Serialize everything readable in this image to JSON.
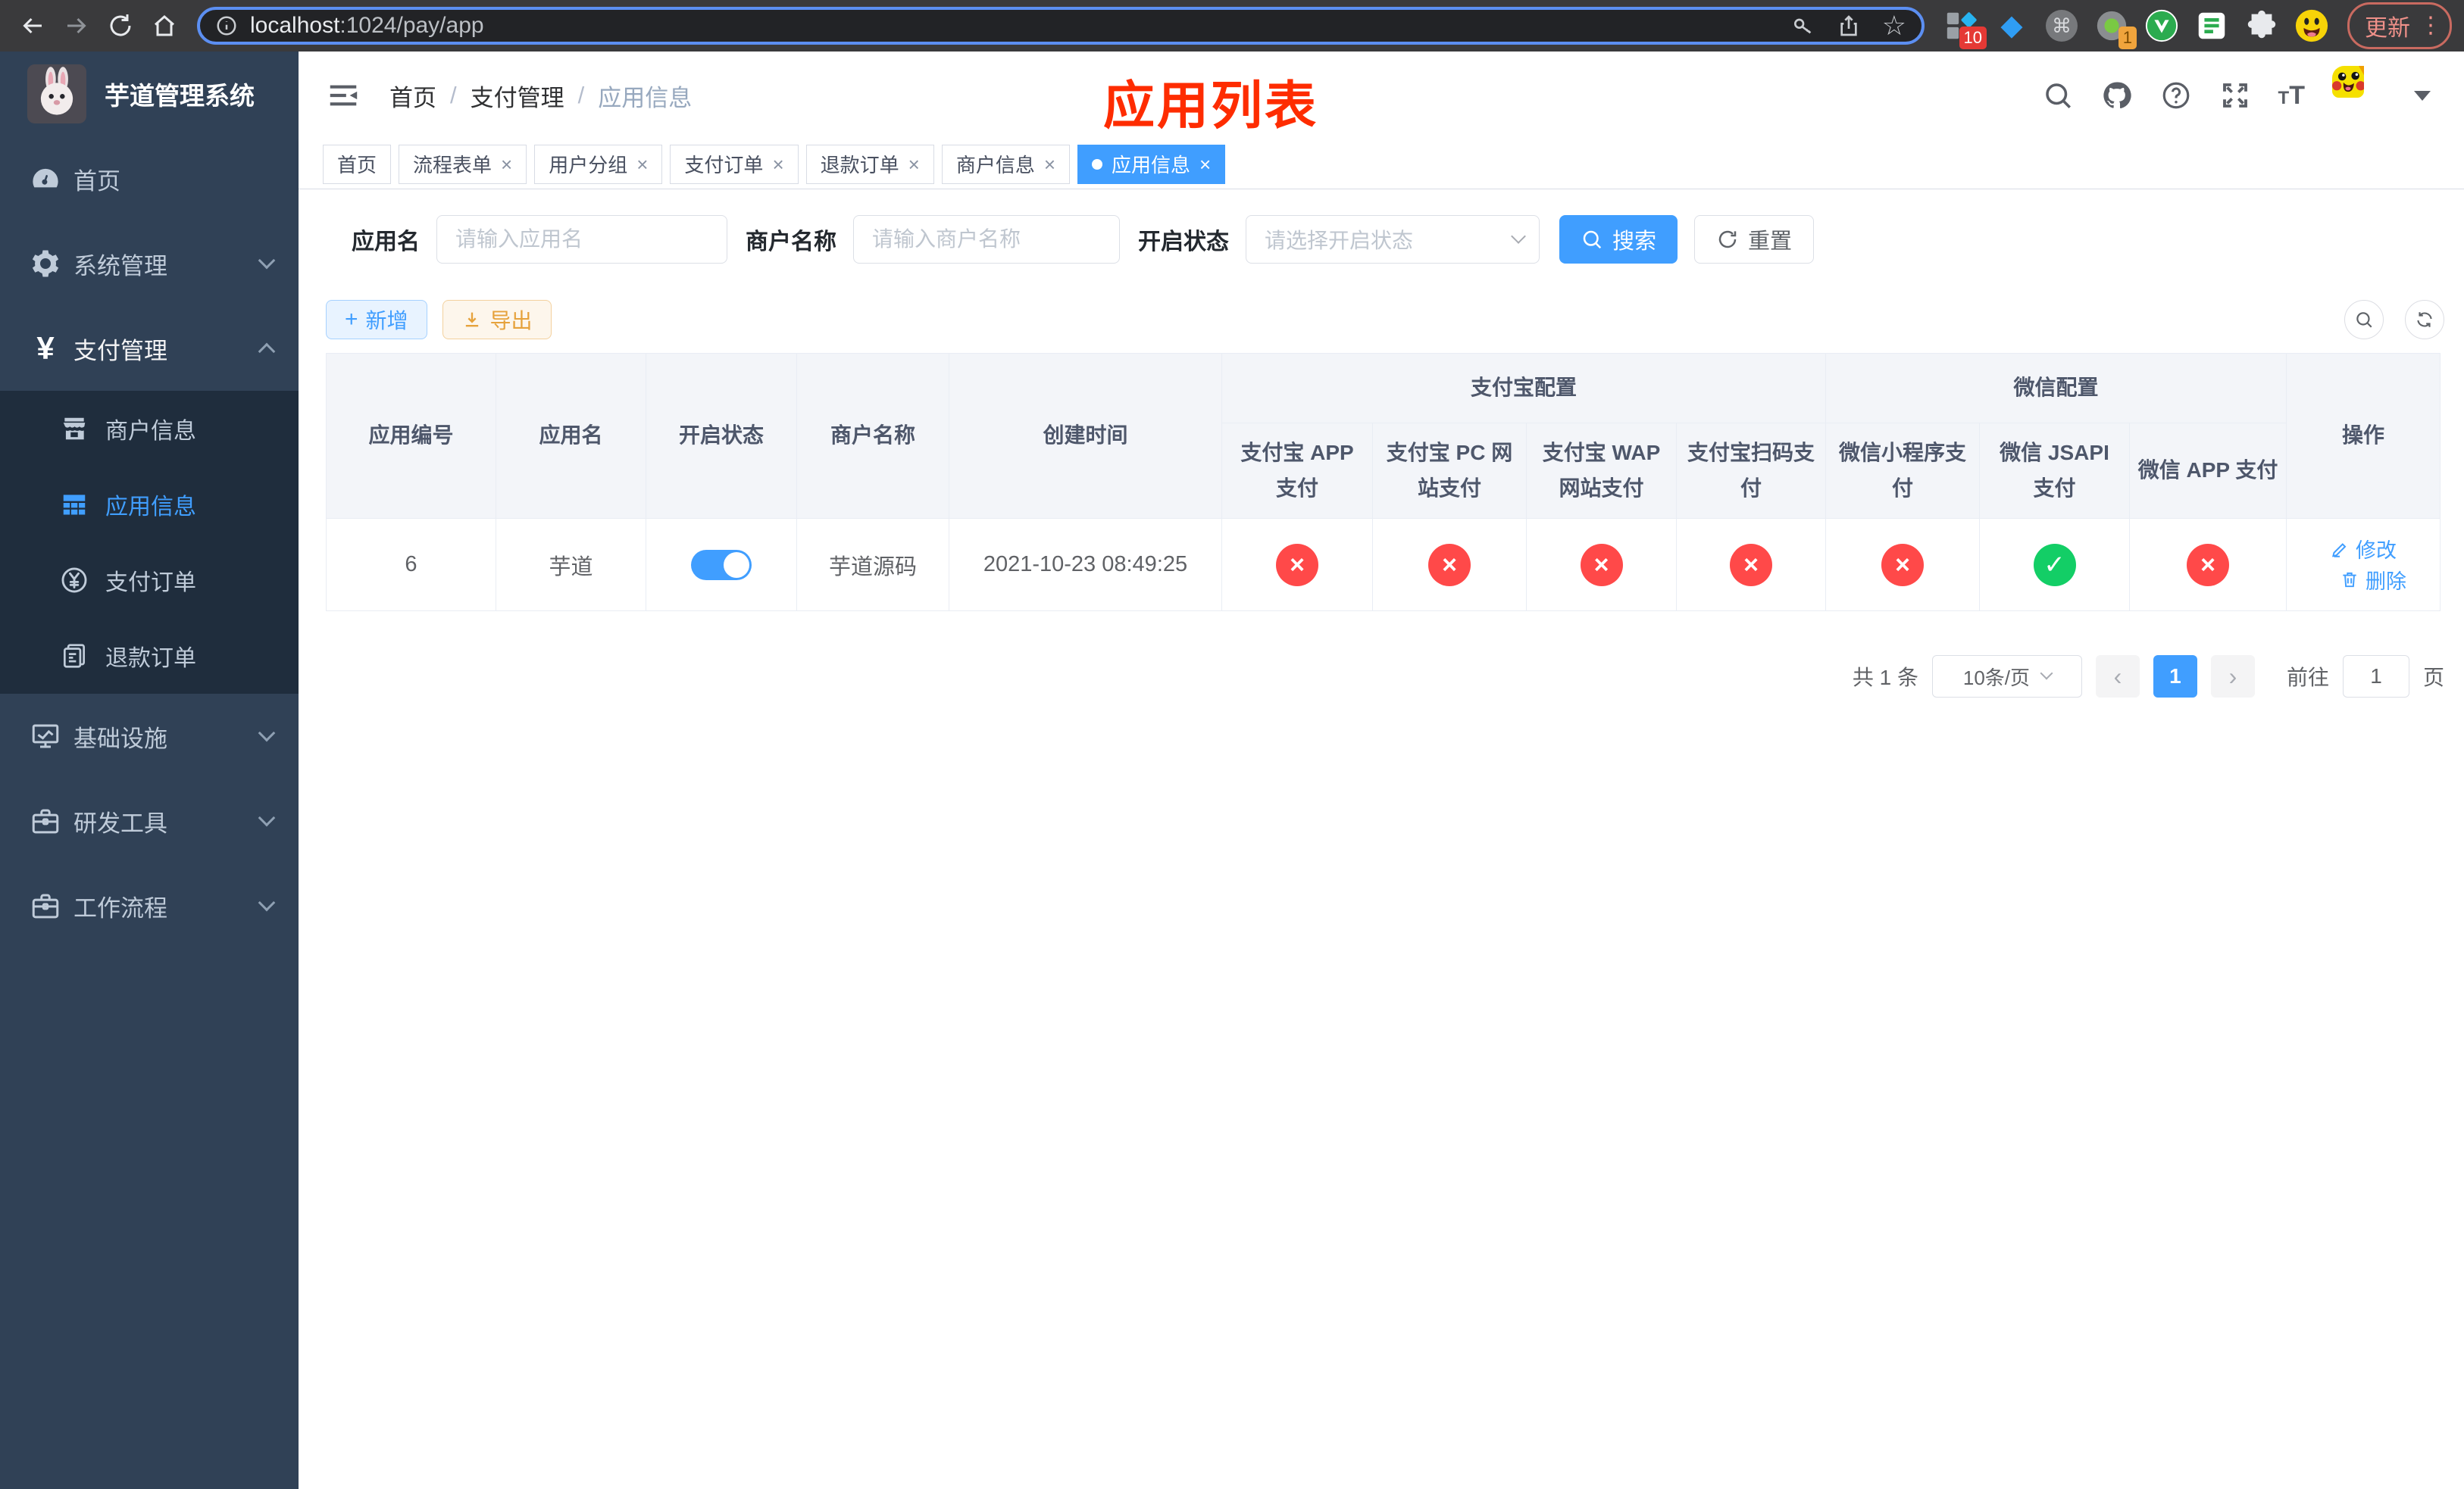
{
  "colors": {
    "primary": "#409eff",
    "success": "#13ce66",
    "danger": "#ff4949",
    "warning": "#e6a23c",
    "sidebar_bg": "#304156",
    "submenu_bg": "#1f2d3d",
    "annotation_red": "#fe2c00"
  },
  "browser": {
    "url_host": "localhost",
    "url_rest": ":1024/pay/app",
    "extension_badge_count": "10",
    "profile_badge_count": "1",
    "update_label": "更新"
  },
  "sidebar": {
    "logo_title": "芋道管理系统",
    "items": [
      {
        "label": "首页",
        "icon": "dashboard-icon"
      },
      {
        "label": "系统管理",
        "icon": "gear-icon"
      },
      {
        "label": "支付管理",
        "icon": "yen-icon",
        "expanded": true,
        "children": [
          {
            "label": "商户信息",
            "icon": "shop-icon"
          },
          {
            "label": "应用信息",
            "icon": "grid-icon",
            "active": true
          },
          {
            "label": "支付订单",
            "icon": "yen-circle-icon"
          },
          {
            "label": "退款订单",
            "icon": "document-icon"
          }
        ]
      },
      {
        "label": "基础设施",
        "icon": "monitor-icon"
      },
      {
        "label": "研发工具",
        "icon": "toolbox-icon"
      },
      {
        "label": "工作流程",
        "icon": "briefcase-icon"
      }
    ]
  },
  "header": {
    "breadcrumb": [
      {
        "label": "首页"
      },
      {
        "label": "支付管理"
      },
      {
        "label": "应用信息"
      }
    ],
    "annotation": "应用列表"
  },
  "tabs": [
    {
      "label": "首页",
      "closable": false,
      "active": false
    },
    {
      "label": "流程表单",
      "closable": true,
      "active": false
    },
    {
      "label": "用户分组",
      "closable": true,
      "active": false
    },
    {
      "label": "支付订单",
      "closable": true,
      "active": false
    },
    {
      "label": "退款订单",
      "closable": true,
      "active": false
    },
    {
      "label": "商户信息",
      "closable": true,
      "active": false
    },
    {
      "label": "应用信息",
      "closable": true,
      "active": true
    }
  ],
  "filters": {
    "app_name_label": "应用名",
    "app_name_placeholder": "请输入应用名",
    "merchant_name_label": "商户名称",
    "merchant_name_placeholder": "请输入商户名称",
    "status_label": "开启状态",
    "status_placeholder": "请选择开启状态",
    "search_label": "搜索",
    "reset_label": "重置"
  },
  "toolbar": {
    "add_label": "新增",
    "export_label": "导出"
  },
  "table": {
    "columns": [
      "应用编号",
      "应用名",
      "开启状态",
      "商户名称",
      "创建时间"
    ],
    "groups": [
      {
        "label": "支付宝配置",
        "children": [
          "支付宝 APP 支付",
          "支付宝 PC 网站支付",
          "支付宝 WAP 网站支付",
          "支付宝扫码支付"
        ]
      },
      {
        "label": "微信配置",
        "children": [
          "微信小程序支付",
          "微信 JSAPI 支付",
          "微信 APP 支付"
        ]
      }
    ],
    "actions_label": "操作",
    "rows": [
      {
        "id": "6",
        "name": "芋道",
        "enabled": true,
        "merchant": "芋道源码",
        "created_at": "2021-10-23 08:49:25",
        "statuses": [
          "closed",
          "closed",
          "closed",
          "closed",
          "closed",
          "open",
          "closed"
        ],
        "actions": [
          {
            "label": "修改"
          },
          {
            "label": "删除"
          }
        ]
      }
    ]
  },
  "pagination": {
    "total": "共 1 条",
    "page_size": "10条/页",
    "current_page": "1",
    "goto_label": "前往",
    "goto_value": "1",
    "page_unit": "页"
  }
}
